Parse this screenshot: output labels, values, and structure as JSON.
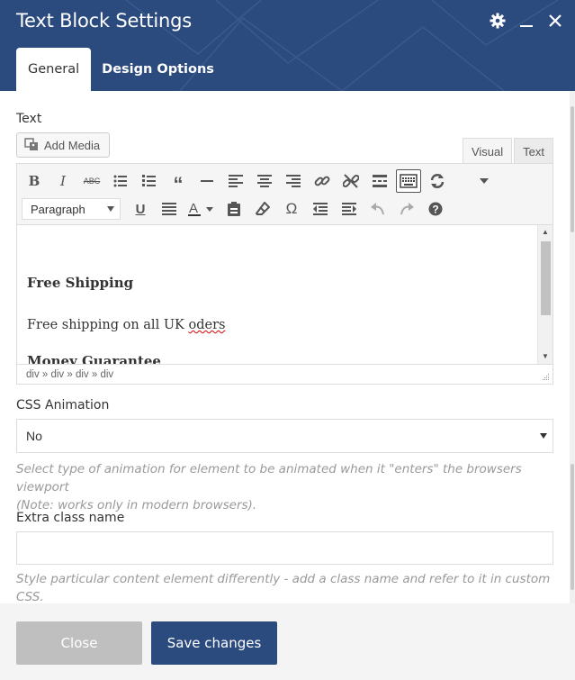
{
  "window": {
    "title": "Text Block Settings",
    "tabs": [
      {
        "label": "General",
        "active": true
      },
      {
        "label": "Design Options",
        "active": false
      }
    ]
  },
  "text_field": {
    "label": "Text",
    "add_media_label": "Add Media",
    "mode_tabs": [
      "Visual",
      "Text"
    ],
    "active_mode": "Visual",
    "format_select": "Paragraph",
    "content": {
      "heading1": "Free Shipping",
      "paragraph1_prefix": "Free shipping on all UK ",
      "paragraph1_misspelled": "oders",
      "heading2": "Money Guarantee"
    },
    "path": "div » div » div » div"
  },
  "css_animation": {
    "label": "CSS Animation",
    "value": "No",
    "help_line1": "Select type of animation for element to be animated when it \"enters\" the browsers viewport",
    "help_line2": "(Note: works only in modern browsers)."
  },
  "extra_class": {
    "label": "Extra class name",
    "value": "",
    "help": "Style particular content element differently - add a class name and refer to it in custom CSS."
  },
  "footer": {
    "close_label": "Close",
    "save_label": "Save changes"
  },
  "colors": {
    "header": "#2b4a7e",
    "save_button": "#2b4a7e",
    "close_button": "#bfbfbf"
  }
}
